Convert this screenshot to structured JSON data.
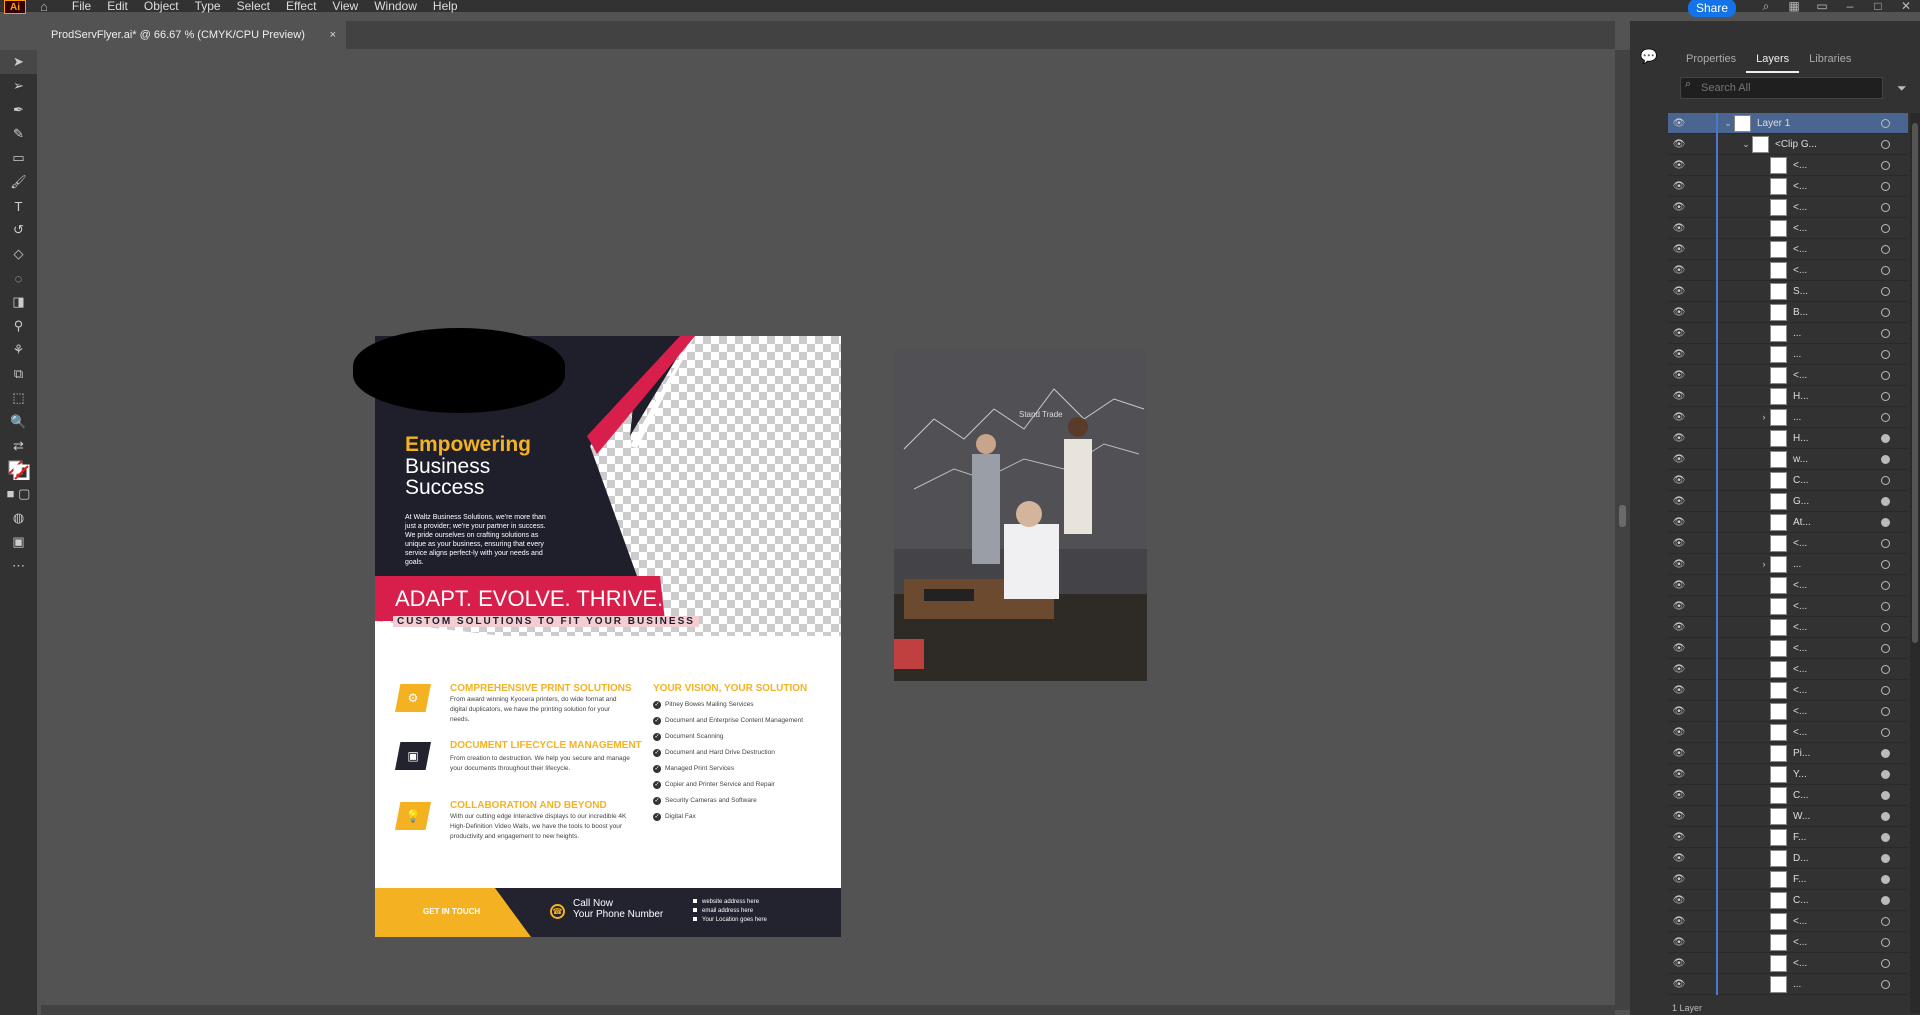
{
  "app": {
    "logo_text": "Ai"
  },
  "menu": [
    "File",
    "Edit",
    "Object",
    "Type",
    "Select",
    "Effect",
    "View",
    "Window",
    "Help"
  ],
  "header": {
    "share_label": "Share"
  },
  "document": {
    "tab_title": "ProdServFlyer.ai* @ 66.67 % (CMYK/CPU Preview)",
    "close_glyph": "×"
  },
  "panel": {
    "tabs": [
      "Properties",
      "Layers",
      "Libraries"
    ],
    "active_tab": "Layers",
    "search_placeholder": "Search All",
    "layers": [
      {
        "name": "Layer 1",
        "level": 0,
        "expanded": true,
        "selected": true,
        "target_filled": false
      },
      {
        "name": "<Clip G...",
        "level": 1,
        "expanded": true,
        "target_filled": false
      },
      {
        "name": "<...",
        "level": 2,
        "target_filled": false
      },
      {
        "name": "<...",
        "level": 2,
        "target_filled": false
      },
      {
        "name": "<...",
        "level": 2,
        "target_filled": false
      },
      {
        "name": "<...",
        "level": 2,
        "target_filled": false
      },
      {
        "name": "<...",
        "level": 2,
        "target_filled": false
      },
      {
        "name": "<...",
        "level": 2,
        "target_filled": false
      },
      {
        "name": "S...",
        "level": 2,
        "target_filled": false
      },
      {
        "name": "B...",
        "level": 2,
        "target_filled": false
      },
      {
        "name": "...",
        "level": 2,
        "target_filled": false
      },
      {
        "name": "...",
        "level": 2,
        "target_filled": false
      },
      {
        "name": "<...",
        "level": 2,
        "target_filled": false
      },
      {
        "name": "H...",
        "level": 2,
        "target_filled": false
      },
      {
        "name": "...",
        "level": 2,
        "collapsed_arrow": true,
        "target_filled": false
      },
      {
        "name": "H...",
        "level": 2,
        "target_filled": true
      },
      {
        "name": "w...",
        "level": 2,
        "target_filled": true
      },
      {
        "name": "C...",
        "level": 2,
        "target_filled": false
      },
      {
        "name": "G...",
        "level": 2,
        "target_filled": true
      },
      {
        "name": "At...",
        "level": 2,
        "target_filled": true
      },
      {
        "name": "<...",
        "level": 2,
        "target_filled": false
      },
      {
        "name": "...",
        "level": 2,
        "collapsed_arrow": true,
        "target_filled": false
      },
      {
        "name": "<...",
        "level": 2,
        "target_filled": false
      },
      {
        "name": "<...",
        "level": 2,
        "target_filled": false
      },
      {
        "name": "<...",
        "level": 2,
        "target_filled": false
      },
      {
        "name": "<...",
        "level": 2,
        "target_filled": false
      },
      {
        "name": "<...",
        "level": 2,
        "target_filled": false
      },
      {
        "name": "<...",
        "level": 2,
        "target_filled": false
      },
      {
        "name": "<...",
        "level": 2,
        "target_filled": false
      },
      {
        "name": "<...",
        "level": 2,
        "target_filled": false
      },
      {
        "name": "Pi...",
        "level": 2,
        "target_filled": true
      },
      {
        "name": "Y...",
        "level": 2,
        "target_filled": true
      },
      {
        "name": "C...",
        "level": 2,
        "target_filled": true
      },
      {
        "name": "W...",
        "level": 2,
        "target_filled": true
      },
      {
        "name": "F...",
        "level": 2,
        "target_filled": true
      },
      {
        "name": "D...",
        "level": 2,
        "target_filled": true
      },
      {
        "name": "F...",
        "level": 2,
        "target_filled": true
      },
      {
        "name": "C...",
        "level": 2,
        "target_filled": true
      },
      {
        "name": "<...",
        "level": 2,
        "target_filled": false
      },
      {
        "name": "<...",
        "level": 2,
        "target_filled": false
      },
      {
        "name": "<...",
        "level": 2,
        "target_filled": false
      },
      {
        "name": "...",
        "level": 2,
        "target_filled": false
      }
    ],
    "footer_text": "1 Layer"
  },
  "flyer": {
    "headline_1": "Empowering",
    "headline_2": "Business",
    "headline_3": "Success",
    "intro": "At Waltz Business Solutions, we're more than just a provider; we're your partner in success. We pride ourselves on crafting solutions as unique as your business, ensuring that every service aligns perfect-ly with your needs and goals.",
    "banner_main": "ADAPT. EVOLVE. THRIVE.",
    "banner_sub": "CUSTOM SOLUTIONS TO FIT YOUR BUSINESS",
    "services": [
      {
        "title": "COMPREHENSIVE PRINT SOLUTIONS",
        "desc": "From award winning Kyocera printers, do wide format and digital duplicators, we have the printing solution for your needs.",
        "icon": "gear-icon",
        "icon_bg": "#f4b223"
      },
      {
        "title": "DOCUMENT LIFECYCLE MANAGEMENT",
        "desc": "From creation to destruction. We help you secure and manage your documents throughout their lifecycle.",
        "icon": "briefcase-icon",
        "icon_bg": "#232330"
      },
      {
        "title": "COLLABORATION AND BEYOND",
        "desc": "With our cutting edge Interactive displays to our incredible 4K High-Definition Video Walls, we have the tools to boost your productivity and engagement to new heights.",
        "icon": "lightbulb-icon",
        "icon_bg": "#f4b223"
      }
    ],
    "vision_title": "YOUR VISION, YOUR SOLUTION",
    "vision_items": [
      "Pitney Bowes Mailing Services",
      "Document and Enterprise Content Management",
      "Document Scanning",
      "Document and Hard Drive Destruction",
      "Managed Print Services",
      "Copier and Printer Service and Repair",
      "Security Cameras and Software",
      "Digital Fax"
    ],
    "cta_label": "GET IN TOUCH",
    "call_line1": "Call Now",
    "call_line2": "Your Phone Number",
    "contact": [
      "website address here",
      "email address here",
      "Your Location goes here"
    ]
  },
  "photo": {
    "board_text": "Stand Trade"
  },
  "colors": {
    "accent_yellow": "#f4b223",
    "accent_red": "#d81e4b",
    "dark_navy": "#1f1f2c",
    "selection_blue": "#4a6590",
    "share_blue": "#1473e6"
  }
}
